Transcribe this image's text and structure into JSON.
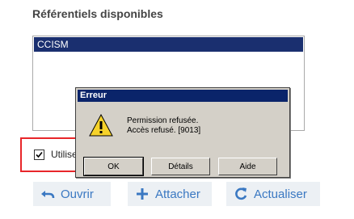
{
  "section": {
    "title": "Référentiels disponibles"
  },
  "list": {
    "items": [
      "CCISM"
    ]
  },
  "checkbox": {
    "label": "Utilise",
    "checked": true
  },
  "actions": {
    "open_label": "Ouvrir",
    "attach_label": "Attacher",
    "refresh_label": "Actualiser"
  },
  "dialog": {
    "title": "Erreur",
    "line1": "Permission refusée.",
    "line2": "Accès refusé. [9013]",
    "buttons": {
      "ok": "OK",
      "details": "Détails",
      "help": "Aide"
    }
  },
  "colors": {
    "accent": "#3a78c2",
    "selection": "#1a2f6f",
    "titlebar": "#0a246a",
    "highlight": "#e8262a"
  }
}
